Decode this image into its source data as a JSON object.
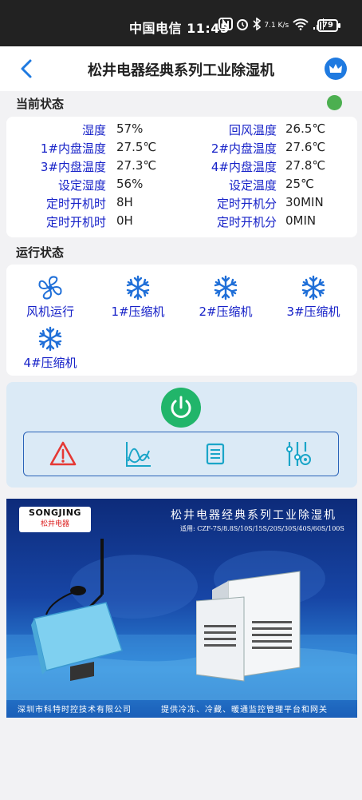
{
  "status_bar": {
    "carrier_time": "中国电信 11:45",
    "net_speed": "7.1 K/s",
    "battery": "79"
  },
  "header": {
    "title": "松井电器经典系列工业除湿机"
  },
  "current_status": {
    "title": "当前状态",
    "rows": [
      {
        "l1": "湿度",
        "v1": "57%",
        "l2": "回风温度",
        "v2": "26.5℃"
      },
      {
        "l1": "1#内盘温度",
        "v1": "27.5℃",
        "l2": "2#内盘温度",
        "v2": "27.6℃"
      },
      {
        "l1": "3#内盘温度",
        "v1": "27.3℃",
        "l2": "4#内盘温度",
        "v2": "27.8℃"
      },
      {
        "l1": "设定湿度",
        "v1": "56%",
        "l2": "设定温度",
        "v2": "25℃"
      },
      {
        "l1": "定时开机时",
        "v1": "8H",
        "l2": "定时开机分",
        "v2": "30MIN"
      },
      {
        "l1": "定时开机时",
        "v1": "0H",
        "l2": "定时开机分",
        "v2": "0MIN"
      }
    ]
  },
  "operation_status": {
    "title": "运行状态",
    "items": [
      {
        "label": "风机运行",
        "icon": "fan-icon"
      },
      {
        "label": "1#压缩机",
        "icon": "snowflake-icon"
      },
      {
        "label": "2#压缩机",
        "icon": "snowflake-icon"
      },
      {
        "label": "3#压缩机",
        "icon": "snowflake-icon"
      },
      {
        "label": "4#压缩机",
        "icon": "snowflake-icon"
      }
    ]
  },
  "controls": {
    "power_icon": "power-icon",
    "tools": [
      "alarm-icon",
      "chart-icon",
      "list-icon",
      "settings-sliders-icon"
    ]
  },
  "banner": {
    "brand_en": "SONGJING",
    "brand_cn": "松井电器",
    "title": "松井电器经典系列工业除湿机",
    "models": "适用: CZF-7S/8.8S/10S/15S/20S/30S/40S/60S/100S",
    "footer_left": "深圳市科特时控技术有限公司",
    "footer_right": "提供冷冻、冷藏、暖通监控管理平台和网关"
  },
  "colors": {
    "accent_blue": "#1722c8",
    "online_green": "#4caf50",
    "power_green": "#21b56a",
    "alarm_red": "#e53935"
  }
}
